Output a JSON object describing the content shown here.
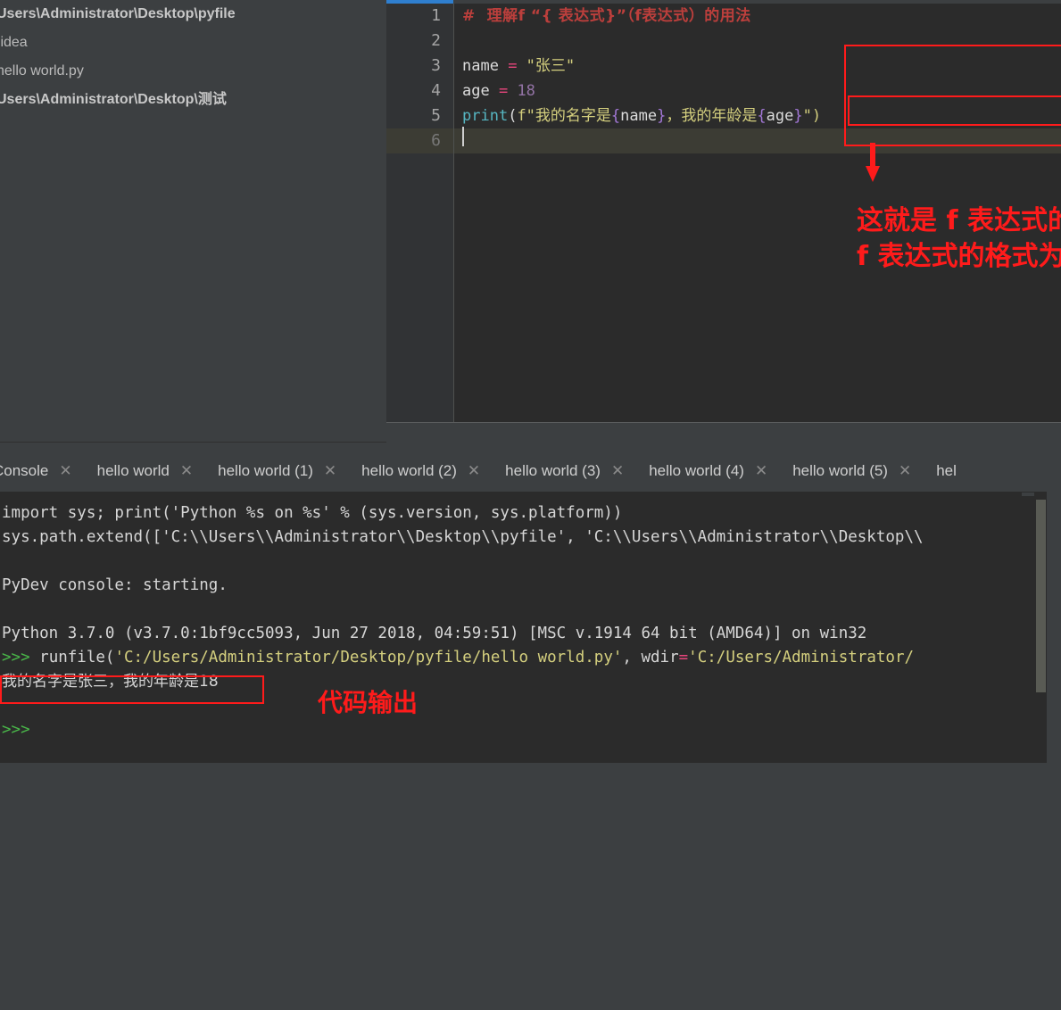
{
  "project": {
    "items": [
      {
        "label": "Users\\Administrator\\Desktop\\pyfile",
        "bold": true
      },
      {
        "label": ".idea",
        "bold": false
      },
      {
        "label": "hello world.py",
        "bold": false
      },
      {
        "label": "Users\\Administrator\\Desktop\\测试",
        "bold": true
      }
    ]
  },
  "editor": {
    "gutter": [
      "1",
      "2",
      "3",
      "4",
      "5",
      "6"
    ],
    "current_line": 6,
    "lines": [
      {
        "n": 1,
        "tokens": [
          {
            "t": "#  理解f “{ 表达式}”（f表达式）的用法",
            "c": "cmt"
          }
        ]
      },
      {
        "n": 2,
        "tokens": []
      },
      {
        "n": 3,
        "tokens": [
          {
            "t": "name",
            "c": "id"
          },
          {
            "t": " = ",
            "c": "op"
          },
          {
            "t": "\"张三\"",
            "c": "str"
          }
        ]
      },
      {
        "n": 4,
        "tokens": [
          {
            "t": "age",
            "c": "id"
          },
          {
            "t": " = ",
            "c": "op"
          },
          {
            "t": "18",
            "c": "num"
          }
        ]
      },
      {
        "n": 5,
        "tokens": [
          {
            "t": "print",
            "c": "fn"
          },
          {
            "t": "(",
            "c": "plain"
          },
          {
            "t": "f\"我的名字是",
            "c": "str"
          },
          {
            "t": "{",
            "c": "brc"
          },
          {
            "t": "name",
            "c": "id"
          },
          {
            "t": "}",
            "c": "brc"
          },
          {
            "t": "，我的年龄是",
            "c": "str"
          },
          {
            "t": "{",
            "c": "brc"
          },
          {
            "t": "age",
            "c": "id"
          },
          {
            "t": "}",
            "c": "brc"
          },
          {
            "t": "\"",
            "c": "str"
          },
          {
            "t": ")",
            "c": "str"
          }
        ]
      },
      {
        "n": 6,
        "tokens": []
      }
    ],
    "annotation": {
      "line1": "这就是 f 表达式的用法",
      "line2": "f 表达式的格式为 f“{表达式}”"
    },
    "highlight_color": "#ff1b1b"
  },
  "console_tabs": {
    "close_glyph": "✕",
    "items": [
      {
        "label": "Console"
      },
      {
        "label": "hello world"
      },
      {
        "label": "hello world (1)"
      },
      {
        "label": "hello world (2)"
      },
      {
        "label": "hello world (3)"
      },
      {
        "label": "hello world (4)"
      },
      {
        "label": "hello world (5)"
      },
      {
        "label": "hel"
      }
    ]
  },
  "console": {
    "lines": [
      {
        "segs": [
          {
            "t": "import sys; print('Python %s on %s' % (sys.version, sys.platform))",
            "c": "c-white"
          }
        ]
      },
      {
        "segs": [
          {
            "t": "sys.path.extend(['C:\\\\Users\\\\Administrator\\\\Desktop\\\\pyfile', 'C:\\\\Users\\\\Administrator\\\\Desktop\\\\",
            "c": "c-white"
          }
        ]
      },
      {
        "segs": []
      },
      {
        "segs": [
          {
            "t": "PyDev console: starting.",
            "c": "c-white"
          }
        ]
      },
      {
        "segs": []
      },
      {
        "segs": [
          {
            "t": "Python 3.7.0 (v3.7.0:1bf9cc5093, Jun 27 2018, 04:59:51) [MSC v.1914 64 bit (AMD64)] on win32",
            "c": "c-white"
          }
        ]
      },
      {
        "segs": [
          {
            "t": ">>> ",
            "c": "c-green"
          },
          {
            "t": "runfile(",
            "c": "c-white"
          },
          {
            "t": "'C:/Users/Administrator/Desktop/pyfile/hello world.py'",
            "c": "c-yellow"
          },
          {
            "t": ", wdir",
            "c": "c-white"
          },
          {
            "t": "=",
            "c": "c-pink"
          },
          {
            "t": "'C:/Users/Administrator/",
            "c": "c-yellow"
          }
        ]
      },
      {
        "segs": [
          {
            "t": "我的名字是张三，我的年龄是18",
            "c": "c-white c-cn"
          }
        ]
      },
      {
        "segs": []
      },
      {
        "segs": [
          {
            "t": ">>>",
            "c": "c-green"
          }
        ]
      }
    ],
    "output_annotation": "代码输出"
  }
}
